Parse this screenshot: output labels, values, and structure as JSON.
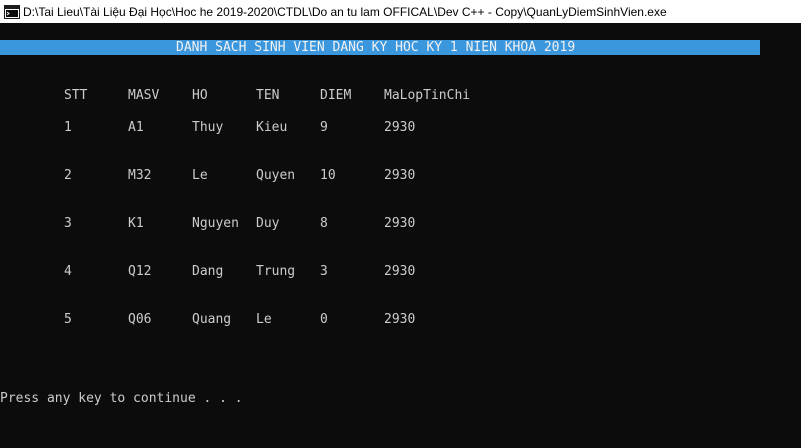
{
  "window": {
    "title": "D:\\Tai Lieu\\Tài Liệu Đại Học\\Hoc he 2019-2020\\CTDL\\Do an tu lam OFFICAL\\Dev C++ - Copy\\QuanLyDiemSinhVien.exe",
    "icon": "console-app-icon"
  },
  "console": {
    "banner": "DANH SACH SINH VIEN DANG KY HOC KY 1 NIEN KHOA 2019",
    "columns": [
      "STT",
      "MASV",
      "HO",
      "TEN",
      "DIEM",
      "MaLopTinChi"
    ],
    "rows": [
      [
        "1",
        "A1",
        "Thuy",
        "Kieu",
        "9",
        "2930"
      ],
      [
        "2",
        "M32",
        "Le",
        "Quyen",
        "10",
        "2930"
      ],
      [
        "3",
        "K1",
        "Nguyen",
        "Duy",
        "8",
        "2930"
      ],
      [
        "4",
        "Q12",
        "Dang",
        "Trung",
        "3",
        "2930"
      ],
      [
        "5",
        "Q06",
        "Quang",
        "Le",
        "0",
        "2930"
      ]
    ],
    "prompt": "Press any key to continue . . ."
  },
  "colors": {
    "background": "#0c0c0c",
    "text": "#cccccc",
    "banner_bg": "#3a96dd",
    "banner_text": "#f2f2f2",
    "titlebar_bg": "#ffffff"
  }
}
